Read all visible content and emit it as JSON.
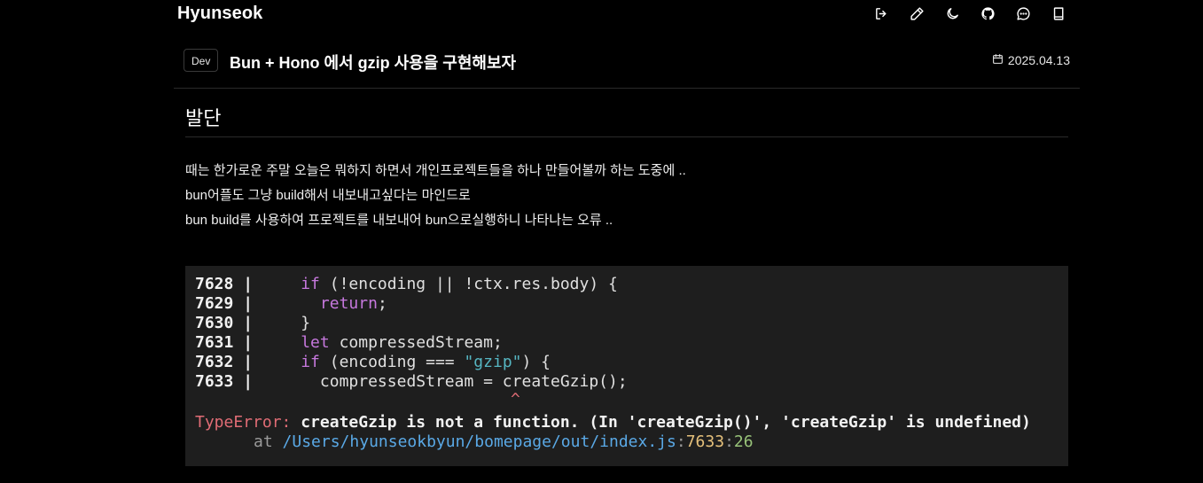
{
  "header": {
    "brand": "Hyunseok",
    "icons": [
      "logout-icon",
      "pencil-icon",
      "moon-icon",
      "github-icon",
      "message-icon",
      "book-icon"
    ]
  },
  "post": {
    "tag": "Dev",
    "title": "Bun + Hono 에서 gzip 사용을 구현해보자",
    "date": "2025.04.13"
  },
  "content": {
    "section_title": "발단",
    "paragraphs": [
      "때는 한가로운 주말 오늘은 뭐하지 하면서 개인프로젝트들을 하나 만들어볼까 하는 도중에 ..",
      "bun어플도 그냥 build해서 내보내고싶다는 마인드로",
      "bun build를 사용하여 프로젝트를 내보내어 bun으로실행하니 나타나는 오류 .."
    ]
  },
  "code": {
    "lines": [
      {
        "num": "7628",
        "code_kw": "if",
        "code_rest": " (!encoding || !ctx.res.body) {"
      },
      {
        "num": "7629",
        "code_kw": "return",
        "code_rest": ";"
      },
      {
        "num": "7630",
        "code_kw": "",
        "code_rest": "}"
      },
      {
        "num": "7631",
        "code_kw": "let",
        "code_rest": " compressedStream;"
      },
      {
        "num": "7632",
        "code_kw": "if",
        "code_rest": " (encoding === ",
        "code_str": "\"gzip\"",
        "code_tail": ") {"
      },
      {
        "num": "7633",
        "code_kw": "",
        "code_rest": "compressedStream = createGzip();"
      }
    ],
    "caret": "^",
    "error_name": "TypeError:",
    "error_message": "createGzip is not a function. (In 'createGzip()', 'createGzip' is undefined)",
    "at": "at",
    "path": "/Users/hyunseokbyun/bomepage/out/index.js",
    "line_no": "7633",
    "col_no": "26"
  },
  "colors": {
    "background": "#000000",
    "code_background": "#1e1e1e",
    "keyword": "#c678dd",
    "string": "#56b6c2",
    "error": "#e06c75",
    "path": "#5aa9e6"
  }
}
